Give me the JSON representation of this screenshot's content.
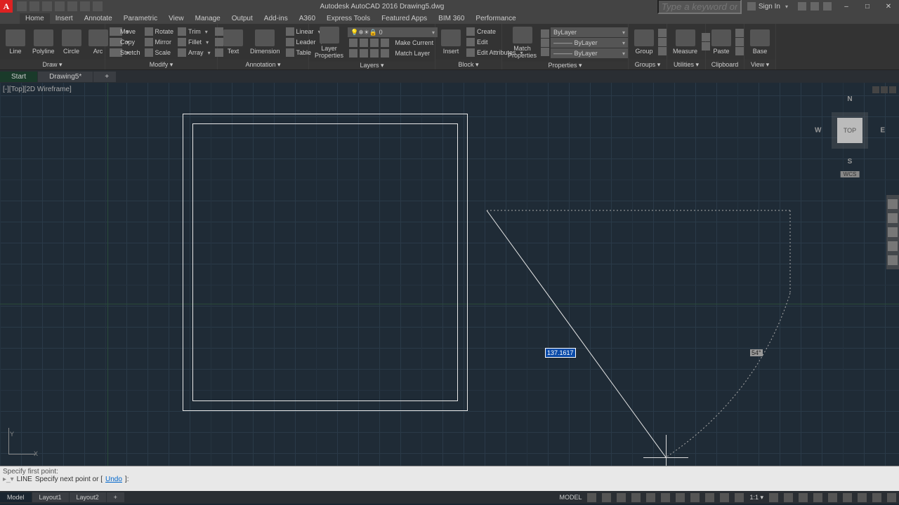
{
  "title": "Autodesk AutoCAD 2016    Drawing5.dwg",
  "search_placeholder": "Type a keyword or phrase",
  "signin": "Sign In",
  "tabs": [
    "Home",
    "Insert",
    "Annotate",
    "Parametric",
    "View",
    "Manage",
    "Output",
    "Add-ins",
    "A360",
    "Express Tools",
    "Featured Apps",
    "BIM 360",
    "Performance"
  ],
  "panels": {
    "draw": {
      "title": "Draw ▾",
      "items": [
        "Line",
        "Polyline",
        "Circle",
        "Arc"
      ]
    },
    "modify": {
      "title": "Modify ▾",
      "r1": [
        "Move",
        "Rotate",
        "Trim"
      ],
      "r2": [
        "Copy",
        "Mirror",
        "Fillet"
      ],
      "r3": [
        "Stretch",
        "Scale",
        "Array"
      ]
    },
    "annotation": {
      "title": "Annotation ▾",
      "big": [
        "Text",
        "Dimension"
      ],
      "side": [
        "Linear",
        "Leader",
        "Table"
      ]
    },
    "layers": {
      "title": "Layers ▾",
      "big": "Layer\nProperties",
      "layer0": "0",
      "make": "Make Current",
      "match": "Match Layer"
    },
    "block": {
      "title": "Block ▾",
      "big": "Insert",
      "side": [
        "Create",
        "Edit",
        "Edit Attributes"
      ]
    },
    "properties": {
      "title": "Properties ▾",
      "big": "Match\nProperties",
      "bylayer": "ByLayer"
    },
    "groups": {
      "title": "Groups ▾",
      "big": "Group"
    },
    "utilities": {
      "title": "Utilities ▾",
      "big": "Measure"
    },
    "clipboard": {
      "title": "Clipboard",
      "big": "Paste"
    },
    "view": {
      "title": "View ▾",
      "big": "Base"
    }
  },
  "filetabs": {
    "start": "Start",
    "drawing": "Drawing5*"
  },
  "viewport_label": "[-][Top][2D Wireframe]",
  "viewcube": {
    "n": "N",
    "s": "S",
    "e": "E",
    "w": "W",
    "top": "TOP",
    "wcs": "WCS"
  },
  "dynamic_input": "137.1617",
  "dynamic_angle": "54°",
  "ucs": {
    "x": "X",
    "y": "Y"
  },
  "cmd": {
    "hist": "Specify first point:",
    "prompt_cmd": "LINE",
    "prompt_text": "Specify next point or [",
    "prompt_opt": "Undo",
    "prompt_end": "]:"
  },
  "status": {
    "model": "Model",
    "layout1": "Layout1",
    "layout2": "Layout2",
    "right_model": "MODEL"
  }
}
